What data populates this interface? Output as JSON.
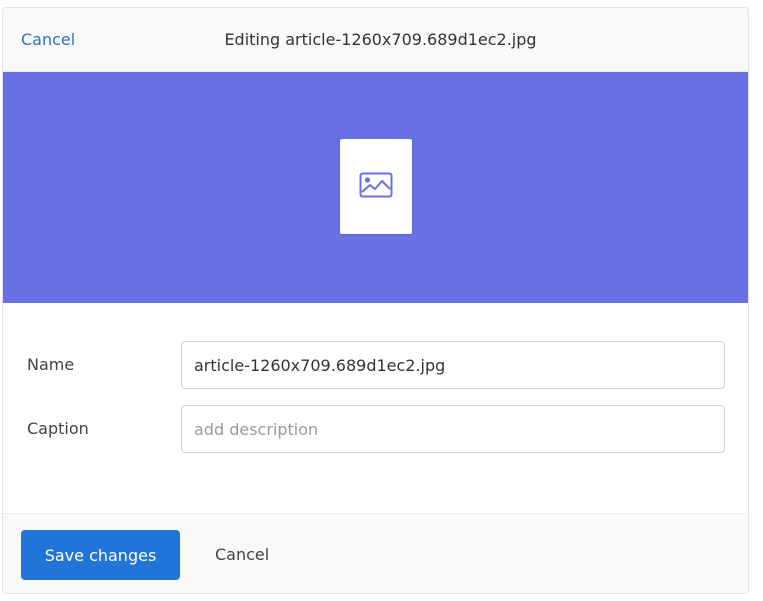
{
  "header": {
    "cancel_label": "Cancel",
    "title": "Editing article-1260x709.689d1ec2.jpg"
  },
  "preview": {
    "background_color": "#6970e3",
    "icon": "image-icon"
  },
  "form": {
    "name_label": "Name",
    "name_value": "article-1260x709.689d1ec2.jpg",
    "caption_label": "Caption",
    "caption_placeholder": "add description",
    "caption_value": ""
  },
  "footer": {
    "save_label": "Save changes",
    "cancel_label": "Cancel",
    "accent_color": "#2174d8"
  }
}
